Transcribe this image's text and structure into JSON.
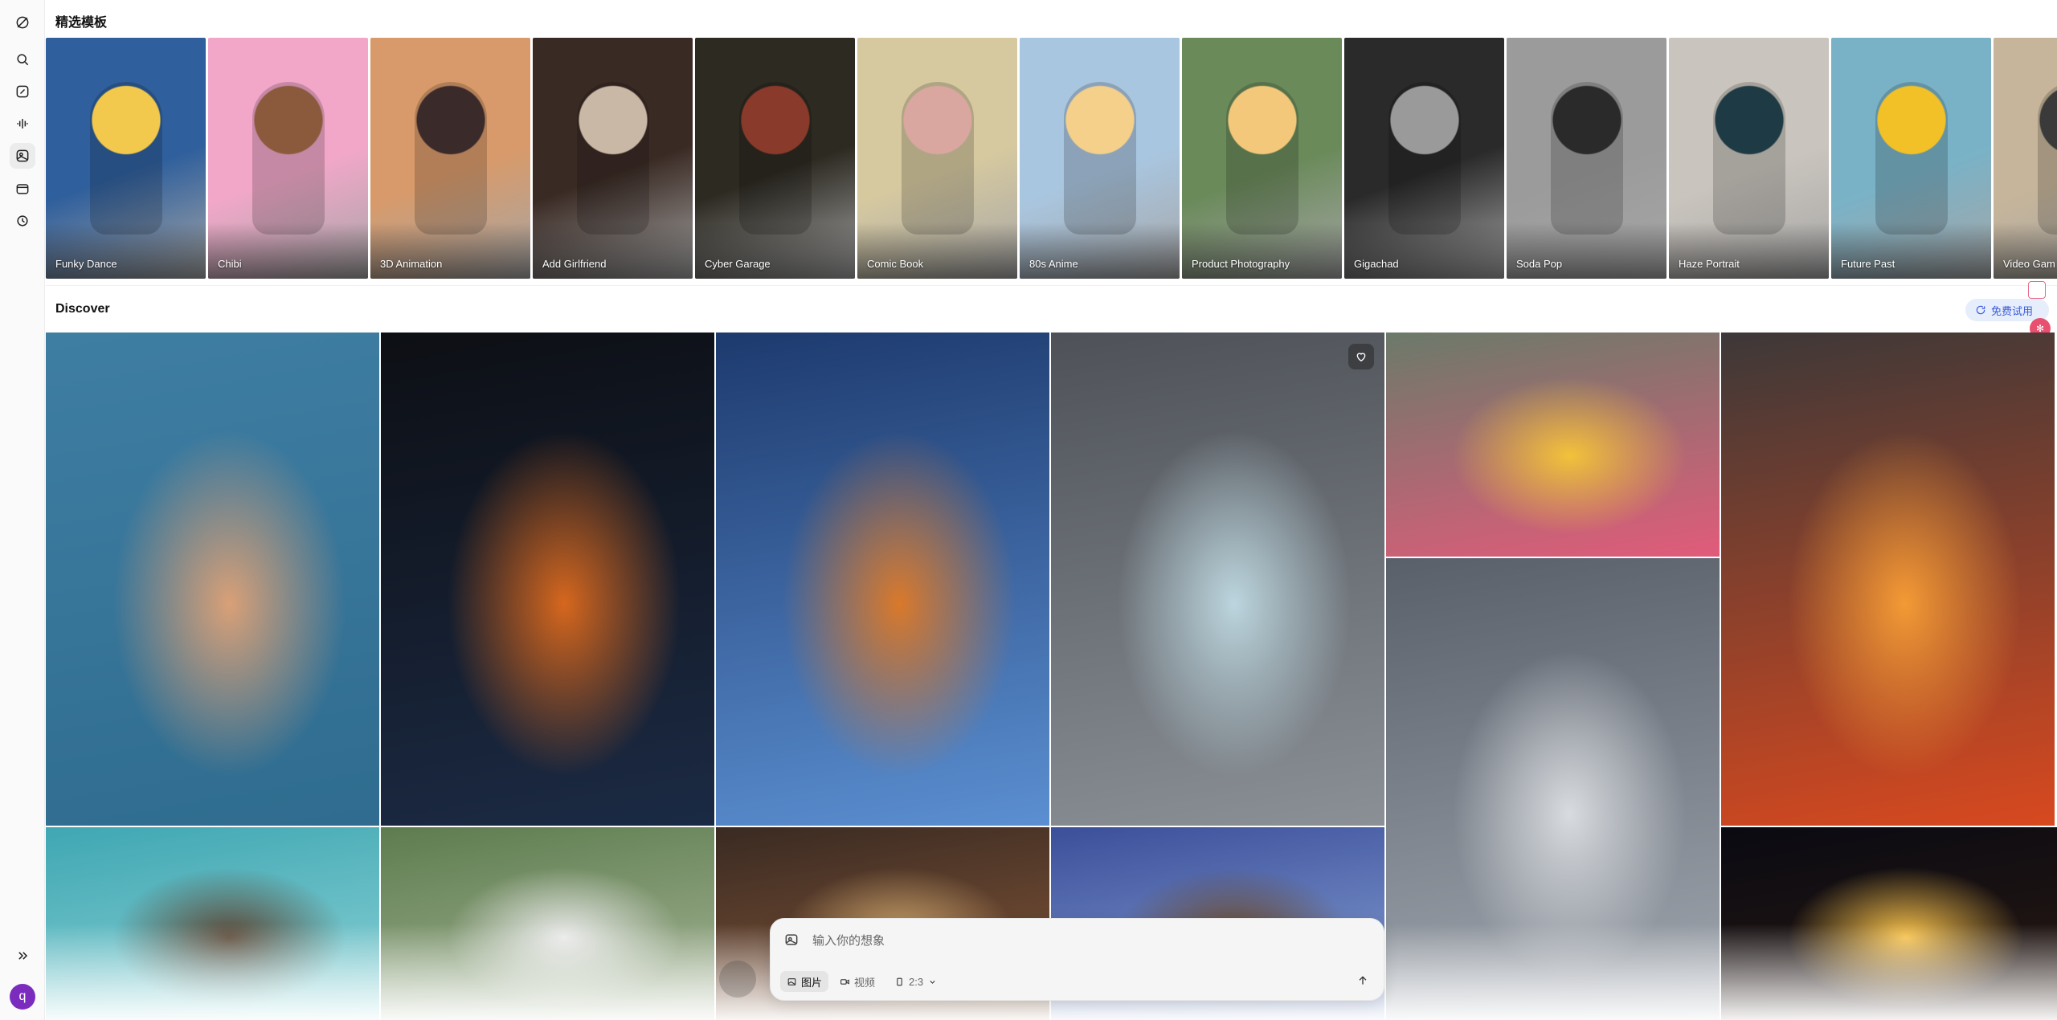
{
  "sidebar": {
    "items": [
      {
        "name": "logo-icon"
      },
      {
        "name": "search-icon"
      },
      {
        "name": "edit-icon"
      },
      {
        "name": "audio-wave-icon"
      },
      {
        "name": "image-gallery-icon"
      },
      {
        "name": "folder-icon"
      },
      {
        "name": "history-icon"
      }
    ],
    "expand_icon": "chevrons-right-icon",
    "avatar_initial": "q",
    "avatar_color": "#7b2cbf"
  },
  "featured": {
    "title": "精选模板",
    "templates": [
      {
        "label": "Funky Dance",
        "bg": "#2f5f9c",
        "accent": "#f2c94c"
      },
      {
        "label": "Chibi",
        "bg": "#f2a7c9",
        "accent": "#8b5a3c"
      },
      {
        "label": "3D Animation",
        "bg": "#d89a6a",
        "accent": "#3b2a2a"
      },
      {
        "label": "Add Girlfriend",
        "bg": "#3a2a24",
        "accent": "#c9b8a6"
      },
      {
        "label": "Cyber Garage",
        "bg": "#2d2a22",
        "accent": "#8a3a2a"
      },
      {
        "label": "Comic Book",
        "bg": "#d6c9a0",
        "accent": "#d9a7a0"
      },
      {
        "label": "80s Anime",
        "bg": "#a9c6e0",
        "accent": "#f4d08a"
      },
      {
        "label": "Product Photography",
        "bg": "#6a8a5a",
        "accent": "#f3c87a"
      },
      {
        "label": "Gigachad",
        "bg": "#2a2a2a",
        "accent": "#9a9a9a"
      },
      {
        "label": "Soda Pop",
        "bg": "#9b9b9b",
        "accent": "#2a2a2a"
      },
      {
        "label": "Haze Portrait",
        "bg": "#c9c4bd",
        "accent": "#1e3a44"
      },
      {
        "label": "Future Past",
        "bg": "#79b2c7",
        "accent": "#f2c027"
      },
      {
        "label": "Video Gam",
        "bg": "#c6b59a",
        "accent": "#3a3a3a"
      }
    ]
  },
  "discover": {
    "title": "Discover",
    "tiles": [
      {
        "name": "tile-curly-hair-woman",
        "colors": [
          "#3f7ea3",
          "#2f6c8f",
          "#d9a077"
        ]
      },
      {
        "name": "tile-chrome-head",
        "colors": [
          "#0d0f14",
          "#1b2a44",
          "#d6671e"
        ]
      },
      {
        "name": "tile-cartoon-fisher",
        "colors": [
          "#1d3a6e",
          "#5b8fd1",
          "#d9792b"
        ]
      },
      {
        "name": "tile-airplane-window-seal",
        "colors": [
          "#4e5258",
          "#8a9096",
          "#bcd5de"
        ]
      },
      {
        "name": "tile-flower-bouquet",
        "colors": [
          "#6b7a6a",
          "#e15b7a",
          "#f2c23a"
        ]
      },
      {
        "name": "tile-volcano-lava",
        "colors": [
          "#3d3838",
          "#d8491f",
          "#f39a35"
        ]
      },
      {
        "name": "tile-sky-clouds-jet",
        "colors": [
          "#59606a",
          "#a2a8b0",
          "#d8dbdf"
        ]
      },
      {
        "name": "tile-otters-water",
        "colors": [
          "#3fa7b3",
          "#8fd3d6",
          "#5a4634"
        ]
      },
      {
        "name": "tile-panda-forest",
        "colors": [
          "#5d7c4e",
          "#a9b79a",
          "#e9e9e9"
        ]
      },
      {
        "name": "tile-cozy-room",
        "colors": [
          "#3a2a22",
          "#8a5a3a",
          "#c9a26a"
        ]
      },
      {
        "name": "tile-tree-sky",
        "colors": [
          "#3b4f9a",
          "#8ba5d8",
          "#6b4a2a"
        ]
      },
      {
        "name": "tile-sun-space",
        "colors": [
          "#0a0a12",
          "#2a1a12",
          "#f6c04a"
        ]
      }
    ]
  },
  "free_trial": {
    "label": "免费试用",
    "color": "#3a5bd9"
  },
  "composer": {
    "placeholder": "输入你的想象",
    "chips": {
      "image": "图片",
      "video": "视频",
      "ratio": "2:3"
    }
  }
}
